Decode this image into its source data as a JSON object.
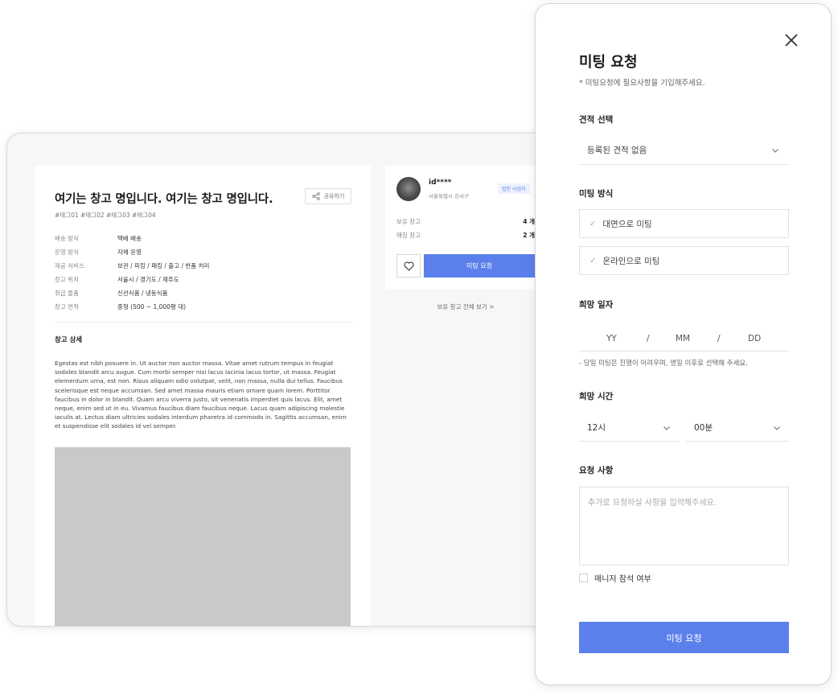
{
  "listing": {
    "title": "여기는 창고 명입니다. 여기는 창고 명입니다.",
    "share_label": "공유하기",
    "tags": "#태그01 #태그02 #태그03 #태그04",
    "specs": [
      {
        "key": "배송 방식",
        "value": "택배 배송"
      },
      {
        "key": "운영 방식",
        "value": "자체 운영"
      },
      {
        "key": "제공 서비스",
        "value": "보관 / 피킹 / 패킹 / 출고 / 반품 처리"
      },
      {
        "key": "창고 위치",
        "value": "서울시 / 경기도 / 제주도"
      },
      {
        "key": "취급 물품",
        "value": "신선식품 / 냉동식품"
      },
      {
        "key": "창고 면적",
        "value": "중형 (500 ~ 1,000평 대)"
      }
    ],
    "detail_title": "창고 상세",
    "detail_text": "Egestas est nibh posuere in. Ut auctor non auctor massa. Vitae amet rutrum tempus in feugiat sodales blandit arcu augue. Cum morbi semper nisi lacus lacinia lacus tortor, ut massa. Feugiat elementum urna, est non. Risus aliquam odio volutpat, velit, non massa, nulla dui tellus. Faucibus scelerisque est neque accumsan. Sed amet massa mauris etiam ornare quam lorem. Porttitor faucibus in dolor in blandit. Quam arcu viverra justo, sit venenatis imperdiet quis lacus. Elit, amet neque, enim sed ut in eu. Vivamus faucibus diam faucibus neque. Lacus quam adipiscing molestie iaculis at. Lectus diam ultricies sodales interdum pharetra id commodo in. Sagittis accumsan, enim et suspendisse elit sodales id vel semper."
  },
  "provider": {
    "user_id": "id****",
    "location": "서울특별시 강서구",
    "badge": "법인 사업자",
    "stats": [
      {
        "label": "보유 창고",
        "value": "4 개"
      },
      {
        "label": "매칭 창고",
        "value": "2 개"
      }
    ],
    "meeting_button": "미팅 요청",
    "view_all": "보유 창고 전체 보기 >"
  },
  "modal": {
    "title": "미팅 요청",
    "subtitle": "* 미팅요청에 필요사항을 기입해주세요.",
    "estimate_label": "견적 선택",
    "estimate_value": "등록된 견적 없음",
    "method_label": "미팅 방식",
    "methods": [
      "대면으로 미팅",
      "온라인으로 미팅"
    ],
    "date_label": "희망 일자",
    "date": {
      "yy": "YY",
      "mm": "MM",
      "dd": "DD",
      "sep": "/"
    },
    "date_note": "- 당일 미팅은 진행이 어려우며, 명일 이후로 선택해 주세요.",
    "time_label": "희망 시간",
    "hour": "12시",
    "minute": "00분",
    "request_label": "요청 사항",
    "request_placeholder": "추가로 요청하실 사항을 입력해주세요.",
    "manager_label": "매니저 참석 여부",
    "submit": "미팅 요청"
  },
  "colors": {
    "accent": "#5c80eb",
    "badge_text": "#5b7be8"
  }
}
